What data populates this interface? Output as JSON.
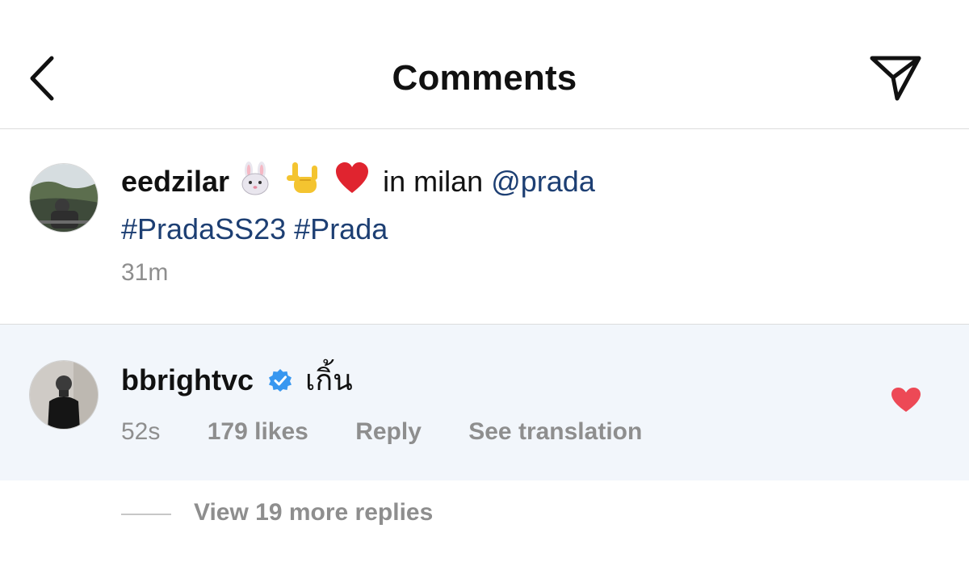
{
  "header": {
    "title": "Comments",
    "back_icon": "chevron-left-icon",
    "send_icon": "paper-plane-icon"
  },
  "caption": {
    "username": "eedzilar",
    "emojis": [
      "rabbit-face-emoji",
      "love-you-gesture-emoji",
      "red-heart-emoji"
    ],
    "text": "in milan",
    "mention": "@prada",
    "hashtags": "#PradaSS23 #Prada",
    "time": "31m"
  },
  "comment": {
    "username": "bbrightvc",
    "verified": true,
    "text": "เกิ้น",
    "time": "52s",
    "likes": "179 likes",
    "reply_label": "Reply",
    "translate_label": "See translation",
    "liked": true,
    "like_color": "#ed4956"
  },
  "replies": {
    "label": "View 19 more replies"
  },
  "colors": {
    "link": "#1d3f73",
    "muted": "#8e8e8e",
    "highlight_bg": "#f2f6fb",
    "verified": "#3897f0"
  }
}
